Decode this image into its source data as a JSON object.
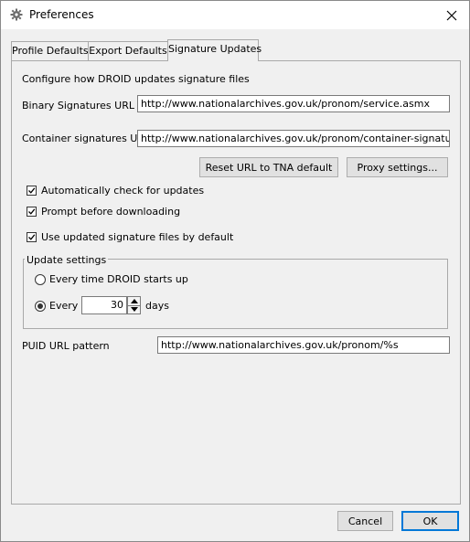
{
  "window": {
    "title": "Preferences"
  },
  "tabs": [
    {
      "label": "Profile Defaults"
    },
    {
      "label": "Export Defaults"
    },
    {
      "label": "Signature Updates"
    }
  ],
  "panel": {
    "intro": "Configure how DROID updates signature files",
    "binary_url_label": "Binary Signatures URL",
    "binary_url_value": "http://www.nationalarchives.gov.uk/pronom/service.asmx",
    "container_url_label": "Container signatures URL",
    "container_url_value": "http://www.nationalarchives.gov.uk/pronom/container-signature.xml",
    "reset_button": "Reset URL to TNA default",
    "proxy_button": "Proxy settings...",
    "auto_check": {
      "label": "Automatically check for updates",
      "checked": true
    },
    "prompt_download": {
      "label": "Prompt before downloading",
      "checked": true
    },
    "use_updated": {
      "label": "Use updated signature files by default",
      "checked": true
    },
    "update_settings": {
      "legend": "Update settings",
      "option_startup": "Every time DROID starts up",
      "option_every": "Every",
      "days_value": "30",
      "days_unit": "days",
      "selected": "every"
    },
    "puid_label": "PUID URL pattern",
    "puid_value": "http://www.nationalarchives.gov.uk/pronom/%s"
  },
  "footer": {
    "cancel": "Cancel",
    "ok": "OK"
  },
  "colors": {
    "default_button_border": "#0078d7",
    "background": "#f0f0f0"
  }
}
